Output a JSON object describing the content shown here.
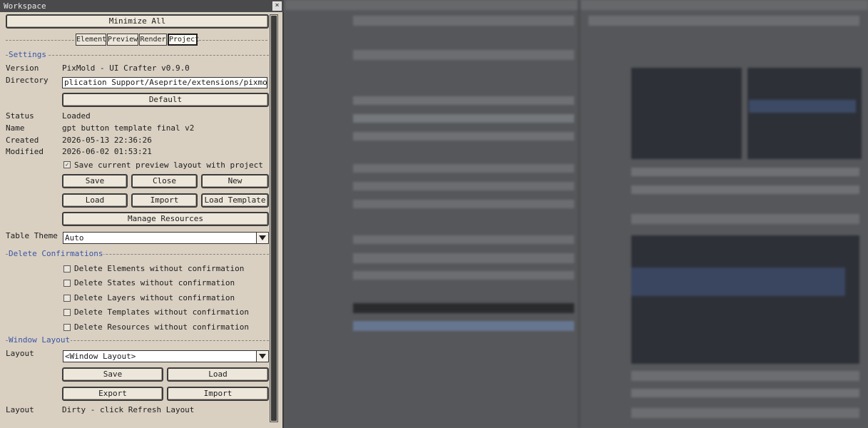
{
  "window": {
    "title": "Workspace",
    "close_glyph": "×"
  },
  "minimize_all_label": "Minimize All",
  "tabs": [
    {
      "label": "Element"
    },
    {
      "label": "Preview"
    },
    {
      "label": "Render"
    },
    {
      "label": "Project",
      "active": true
    }
  ],
  "settings": {
    "header": "Settings",
    "version_label": "Version",
    "version_value": "PixMold - UI Crafter v0.9.0",
    "directory_label": "Directory",
    "directory_value": "plication Support/Aseprite/extensions/pixmold/data",
    "default_button": "Default",
    "status_label": "Status",
    "status_value": "Loaded",
    "name_label": "Name",
    "name_value": "gpt button template final v2",
    "created_label": "Created",
    "created_value": "2026-05-13 22:36:26",
    "modified_label": "Modified",
    "modified_value": "2026-06-02 01:53:21",
    "save_layout_checkbox": "Save current preview layout with project",
    "save_layout_checked": true,
    "buttons": {
      "save": "Save",
      "close": "Close",
      "new": "New",
      "load": "Load",
      "import": "Import",
      "load_template": "Load Template",
      "manage_resources": "Manage Resources"
    },
    "table_theme_label": "Table Theme",
    "table_theme_value": "Auto"
  },
  "delete_confirmations": {
    "header": "Delete Confirmations",
    "items": [
      {
        "label": "Delete Elements without confirmation",
        "checked": false
      },
      {
        "label": "Delete States without confirmation",
        "checked": false
      },
      {
        "label": "Delete Layers without confirmation",
        "checked": false
      },
      {
        "label": "Delete Templates without confirmation",
        "checked": false
      },
      {
        "label": "Delete Resources without confirmation",
        "checked": false
      }
    ]
  },
  "window_layout": {
    "header": "Window Layout",
    "layout_label": "Layout",
    "layout_value": "<Window Layout>",
    "save_button": "Save",
    "load_button": "Load",
    "export_button": "Export",
    "import_button": "Import",
    "status_label": "Layout",
    "status_value": "Dirty - click Refresh Layout"
  },
  "colors": {
    "panel_bg": "#d9d0c2",
    "section_header": "#3a55a5",
    "titlebar": "#4a4a4c",
    "background_workspace": "#55575a"
  }
}
